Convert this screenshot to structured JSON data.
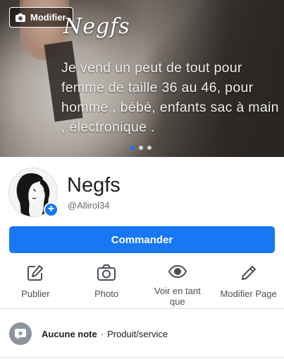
{
  "cover": {
    "edit_label": "Modifier",
    "brand": "Negfs",
    "description": "Je vend un peut de tout pour femme de taille 36 au 46, pour homme , bébé, enfants sac à main , électronique .",
    "slide_count": 3,
    "active_slide": 1
  },
  "profile": {
    "name": "Negfs",
    "handle": "@Allirol34",
    "avatar_icon": "woman-silhouette-logo",
    "add_icon": "plus-icon"
  },
  "cta": {
    "label": "Commander"
  },
  "actions": [
    {
      "label": "Publier",
      "icon": "edit-square-icon"
    },
    {
      "label": "Photo",
      "icon": "camera-icon"
    },
    {
      "label": "Voir en tant que",
      "icon": "eye-icon"
    },
    {
      "label": "Modifier Page",
      "icon": "pencil-icon"
    }
  ],
  "review": {
    "rating": "Aucune note",
    "separator": "·",
    "category": "Produit/service",
    "icon": "star-speech-bubble-icon"
  },
  "colors": {
    "accent": "#1877f2",
    "icon_gray": "#4b4f56",
    "secondary_text": "#65676b"
  }
}
